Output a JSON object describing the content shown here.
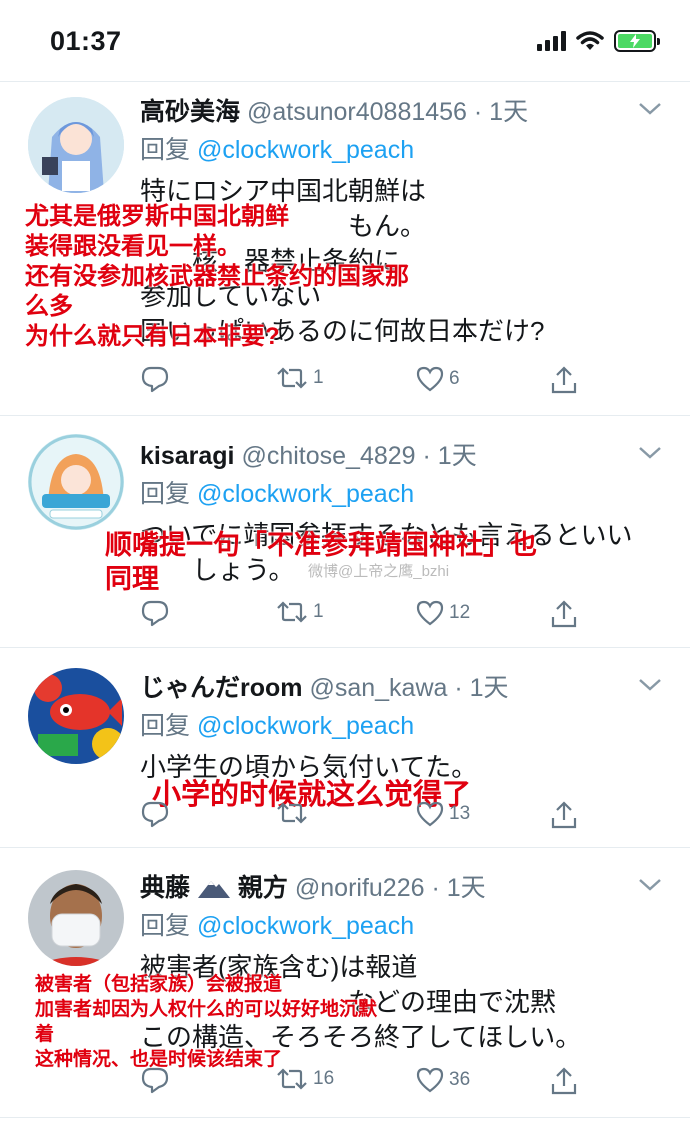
{
  "status": {
    "time": "01:37"
  },
  "tweets": [
    {
      "name": "高砂美海",
      "handle": "@atsunor40881456 · 1天",
      "reply_prefix": "回复 ",
      "reply_to": "@clockwork_peach",
      "text": "特にロシア中国北朝鮮は\n　　　　　　　　もん。\n　　核　器禁止条約に\n参加していない\n国いっぱいあるのに何故日本だけ?",
      "retweets": "1",
      "likes": "6",
      "overlay": "尤其是俄罗斯中国北朝鲜\n装得跟没看见一样。\n还有没参加核武器禁止条约的国家那\n么多\n为什么就只有日本非要?"
    },
    {
      "name": "kisaragi",
      "handle": "@chitose_4829 · 1天",
      "reply_prefix": "回复 ",
      "reply_to": "@clockwork_peach",
      "text": "ついでに靖国参拝するなとも言えるといい\n　　しょう。",
      "retweets": "1",
      "likes": "12",
      "overlay": "顺嘴提一句「不准参拜靖国神社」也\n同理"
    },
    {
      "name": "じゃんだroom",
      "handle": "@san_kawa · 1天",
      "reply_prefix": "回复 ",
      "reply_to": "@clockwork_peach",
      "text": "小学生の頃から気付いてた。",
      "retweets": "",
      "likes": "13",
      "overlay": "小学的时候就这么觉得了"
    },
    {
      "name": "典藤",
      "name_suffix": "親方",
      "handle": "@norifu226 · 1天",
      "reply_prefix": "回复 ",
      "reply_to": "@clockwork_peach",
      "text": "被害者(家族含む)は報道\n　　　　　　　　などの理由で沈黙\nこの構造、そろそろ終了してほしい。",
      "retweets": "16",
      "likes": "36",
      "overlay": "被害者（包括家族）会被报道\n加害者却因为人权什么的可以好好地沉默\n着\n这种情况、也是时候该结束了"
    }
  ],
  "watermark": "微博@上帝之鹰_bzhi"
}
